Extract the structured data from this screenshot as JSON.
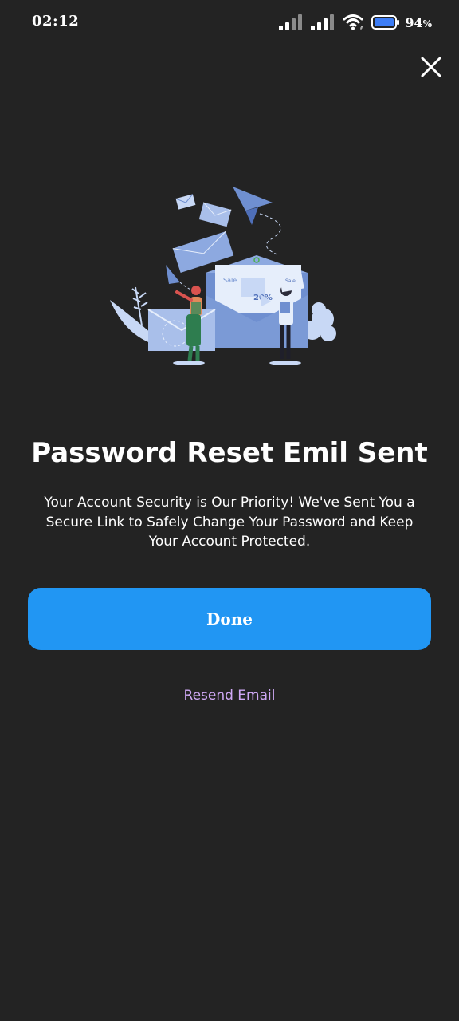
{
  "status_bar": {
    "time": "02:12",
    "battery_percent": "94",
    "battery_suffix": "%",
    "icons": [
      "signal-icon",
      "signal-icon",
      "wifi-icon",
      "battery-icon"
    ]
  },
  "dialog": {
    "close_icon": "close-icon",
    "title": "Password Reset Emil Sent",
    "description": "Your Account Security is Our Priority! We've Sent You a Secure Link to Safely Change Your Password and Keep Your Account Protected.",
    "done_label": "Done",
    "resend_label": "Resend Email"
  },
  "illustration": {
    "sale_label": "Sale",
    "discount_label": "20%",
    "tag_label": "Sale"
  },
  "colors": {
    "background": "#232323",
    "primary_button": "#2196F3",
    "link": "#cfa8f5",
    "illustration_blue": "#6f8fd0",
    "illustration_light": "#c8d8f5"
  }
}
